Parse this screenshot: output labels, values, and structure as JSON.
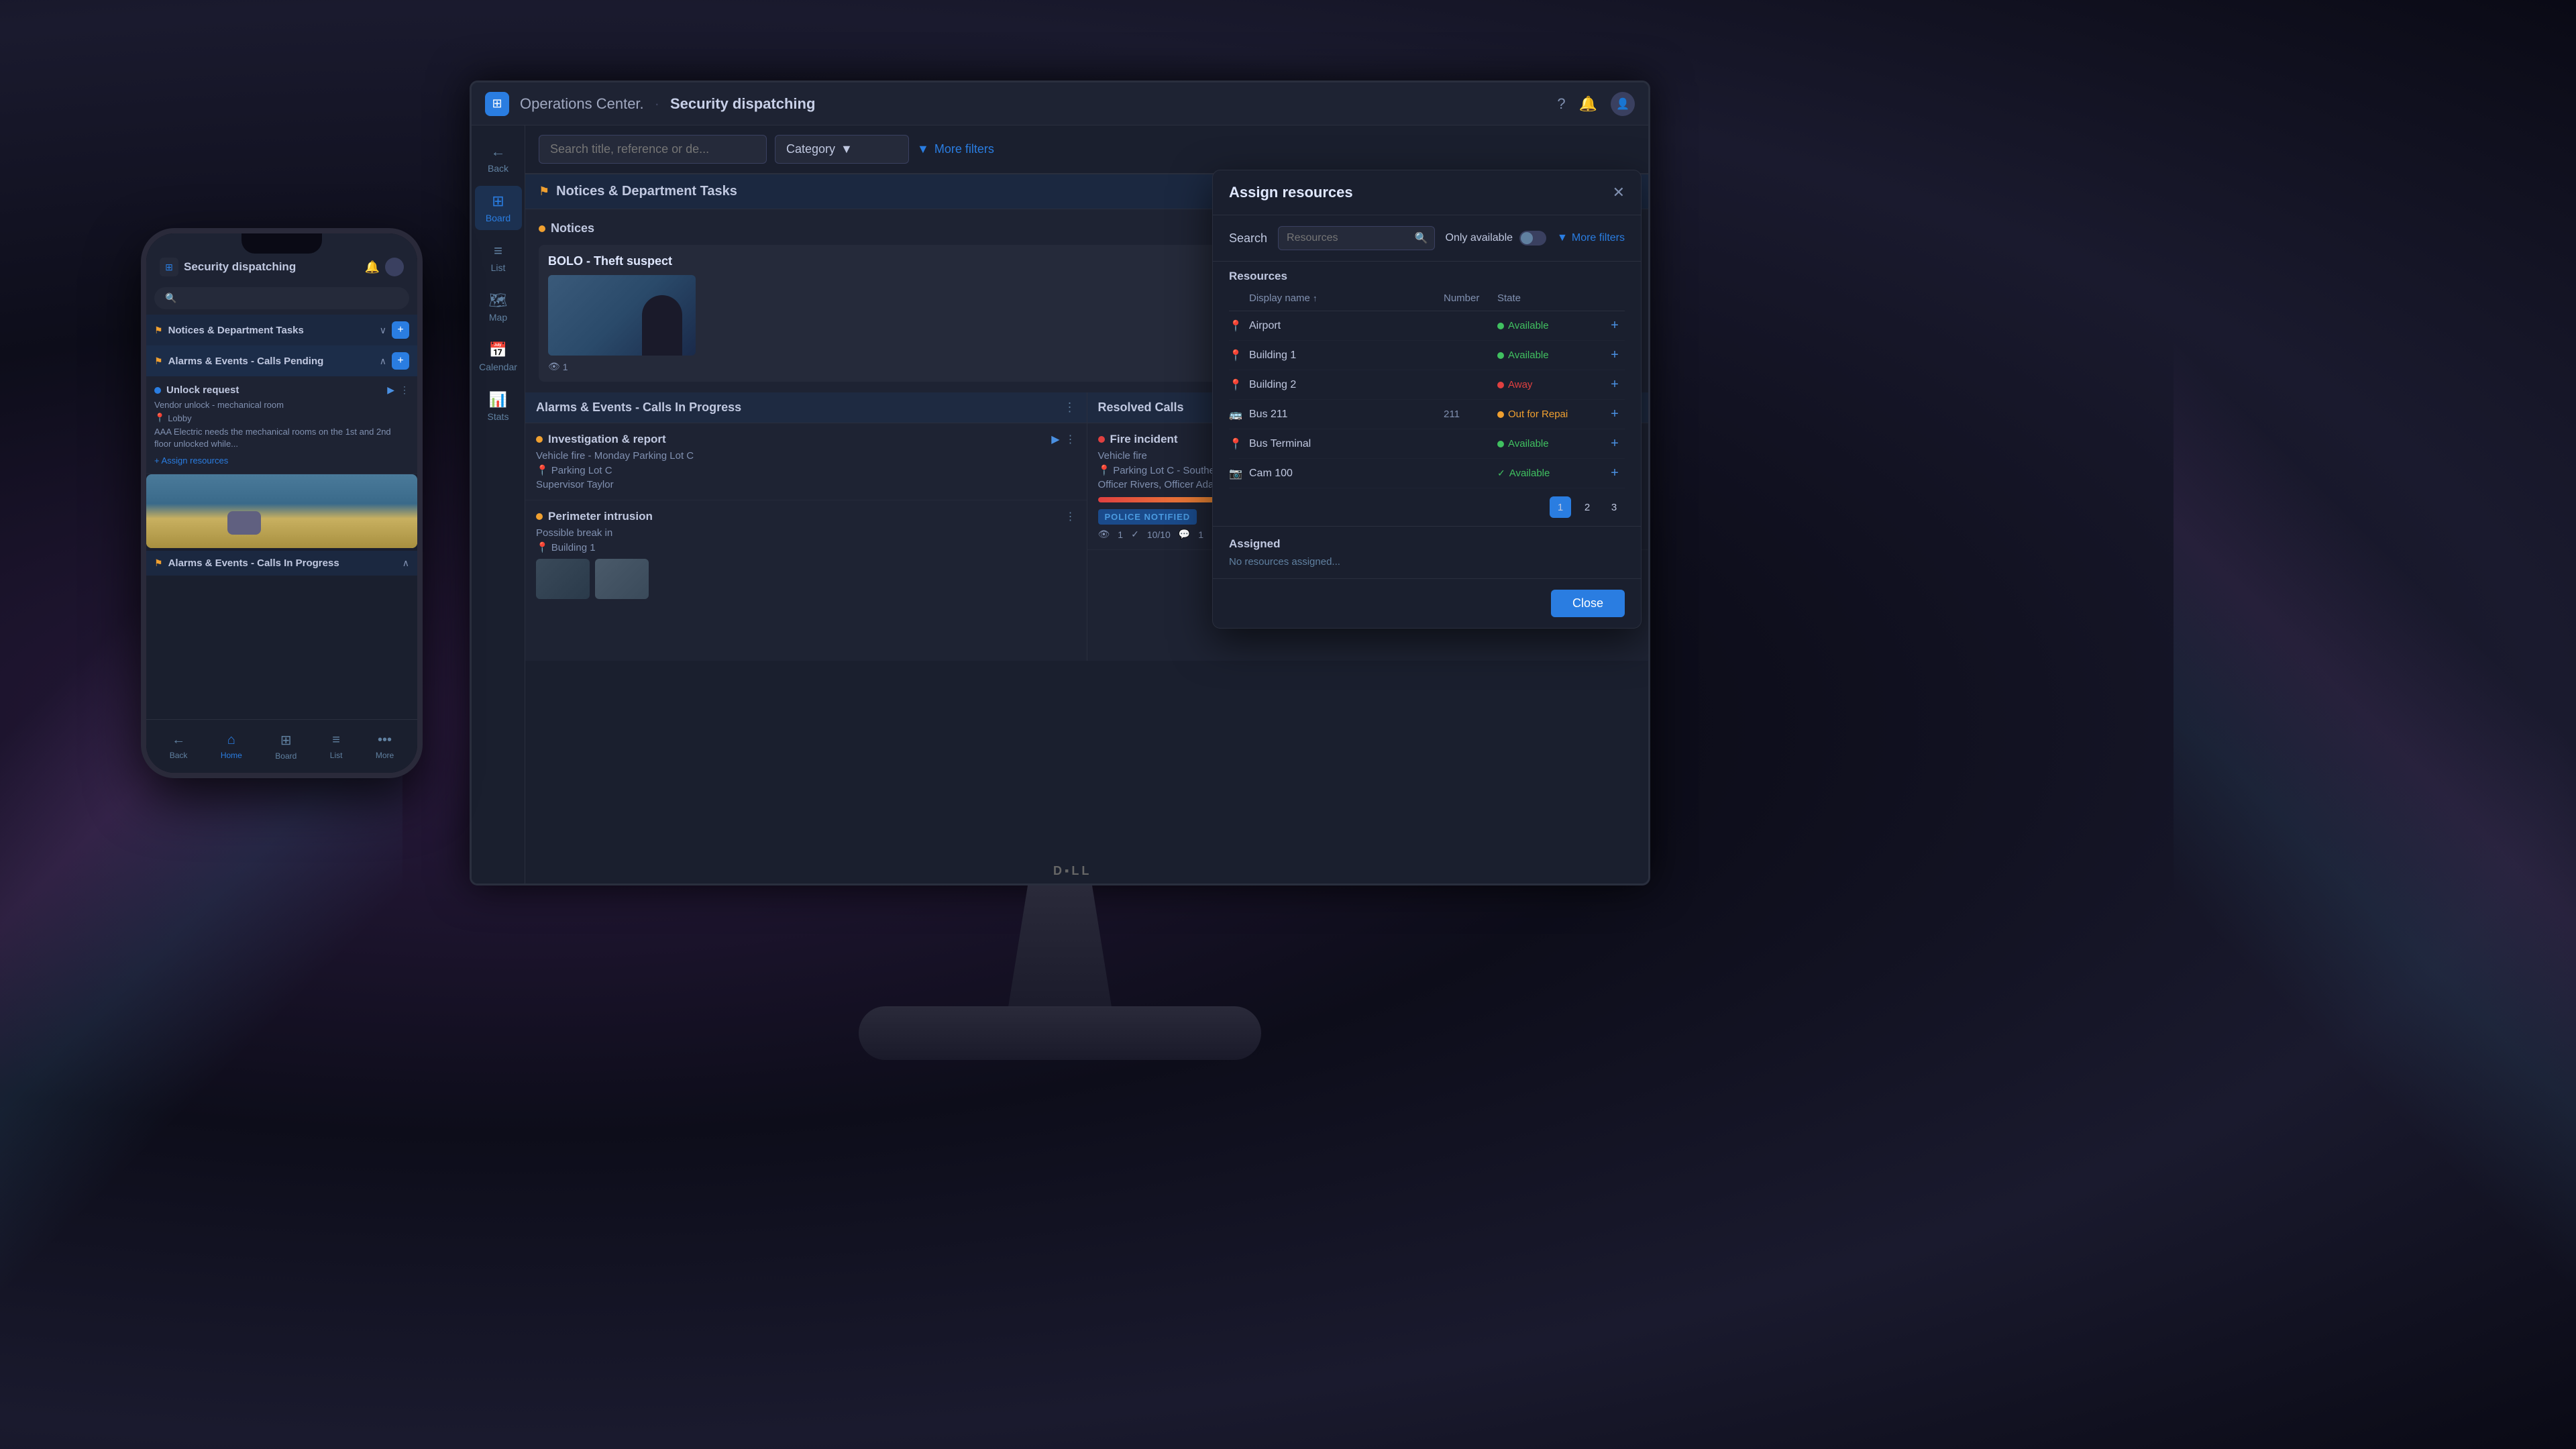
{
  "app": {
    "logo_text": "⊞",
    "name": "Operations Center.",
    "separator": "",
    "title": "Security dispatching"
  },
  "titlebar": {
    "help_icon": "?",
    "bell_icon": "🔔",
    "user_icon": "👤"
  },
  "sidebar": {
    "items": [
      {
        "label": "Back",
        "icon": "←",
        "active": false
      },
      {
        "label": "Board",
        "icon": "⊞",
        "active": true
      },
      {
        "label": "List",
        "icon": "≡",
        "active": false
      },
      {
        "label": "Map",
        "icon": "🗺",
        "active": false
      },
      {
        "label": "Calendar",
        "icon": "📅",
        "active": false
      },
      {
        "label": "Stats",
        "icon": "📊",
        "active": false
      }
    ]
  },
  "search": {
    "placeholder": "Search title, reference or de...",
    "category_label": "Category",
    "more_filters_label": "More filters"
  },
  "sections": {
    "notices_department_tasks": "Notices & Department Tasks",
    "notices": "Notices",
    "notice_title": "BOLO - Theft suspect",
    "notice_count": "1",
    "alarms_calls_in_progress": "Alarms & Events - Calls In Progress",
    "resolved_calls": "Resolved Calls"
  },
  "tasks_in_progress": [
    {
      "title": "Investigation & report",
      "sub": "Vehicle fire - Monday Parking Lot C",
      "location": "Parking Lot C",
      "person": "Supervisor Taylor"
    },
    {
      "title": "Perimeter intrusion",
      "sub": "Possible break in",
      "location": "Building 1"
    }
  ],
  "resolved_calls": [
    {
      "title": "Fire incident",
      "sub": "Vehicle fire",
      "location": "Parking Lot C - Southeast entry",
      "persons": "Officer Rivers, Officer Adams",
      "progress": 100,
      "badge": "POLICE NOTIFIED",
      "meta_views": "1",
      "meta_tasks": "10/10",
      "meta_comments": "1"
    }
  ],
  "assign_panel": {
    "title": "Assign resources",
    "search_label": "Search",
    "search_placeholder": "Resources",
    "only_available_label": "Only available",
    "more_filters_label": "More filters",
    "resources_label": "Resources",
    "col_display_name": "Display name",
    "col_number": "Number",
    "col_state": "State",
    "resources": [
      {
        "icon": "📍",
        "name": "Airport",
        "number": "",
        "state": "Available",
        "state_type": "available"
      },
      {
        "icon": "📍",
        "name": "Building 1",
        "number": "",
        "state": "Available",
        "state_type": "available"
      },
      {
        "icon": "📍",
        "name": "Building 2",
        "number": "",
        "state": "Away",
        "state_type": "away"
      },
      {
        "icon": "🚌",
        "name": "Bus 211",
        "number": "211",
        "state": "Out for Repai",
        "state_type": "repair"
      },
      {
        "icon": "📍",
        "name": "Bus Terminal",
        "number": "",
        "state": "Available",
        "state_type": "available"
      },
      {
        "icon": "📷",
        "name": "Cam 100",
        "number": "",
        "state": "Available",
        "state_type": "check"
      }
    ],
    "pagination": [
      "1",
      "2",
      "3"
    ],
    "current_page": "1",
    "assigned_label": "Assigned",
    "no_resources_label": "No resources assigned...",
    "close_btn": "Close"
  },
  "phone": {
    "app_title": "Security dispatching",
    "sections": {
      "notices_dept": "Notices & Department Tasks",
      "alarms_calls_pending": "Alarms & Events - Calls Pending",
      "alarms_calls_in_progress": "Alarms & Events - Calls In Progress"
    },
    "task": {
      "title": "Unlock request",
      "sub": "Vendor unlock - mechanical room",
      "location": "Lobby",
      "body": "AAA Electric needs the mechanical rooms on the 1st and 2nd floor unlocked while...",
      "assign_btn": "+ Assign resources"
    },
    "nav": [
      {
        "label": "Back",
        "icon": "←",
        "active": false
      },
      {
        "label": "Home",
        "icon": "⌂",
        "active": true
      },
      {
        "label": "Board",
        "icon": "⊞",
        "active": false
      },
      {
        "label": "List",
        "icon": "≡",
        "active": false
      },
      {
        "label": "More",
        "icon": "•••",
        "active": false
      }
    ]
  }
}
